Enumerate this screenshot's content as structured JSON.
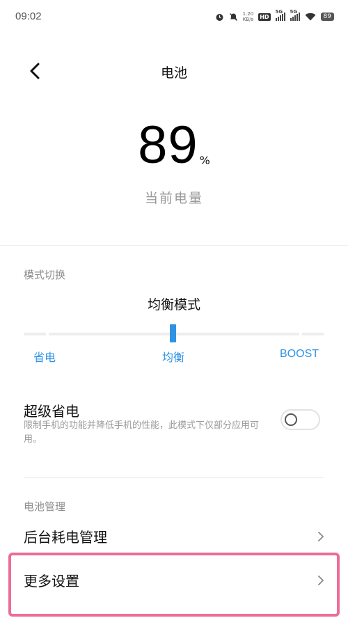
{
  "status_bar": {
    "time": "09:02",
    "net_speed_value": "1.20",
    "net_speed_unit": "KB/s",
    "hd_label": "HD",
    "sim1_label": "5G",
    "sim2_label": "5G",
    "battery_level": "89",
    "icons": [
      "alarm-icon",
      "mute-icon",
      "hd-icon",
      "signal-icon",
      "signal-icon",
      "wifi-icon",
      "battery-icon"
    ]
  },
  "header": {
    "back_icon": "chevron-left-icon",
    "title": "电池"
  },
  "battery": {
    "percent": "89",
    "percent_unit": "%",
    "current_label": "当前电量"
  },
  "mode": {
    "section_label": "模式切换",
    "current_mode": "均衡模式",
    "options": [
      "省电",
      "均衡",
      "BOOST"
    ],
    "selected_index": 1,
    "accent_color": "#2f92e4"
  },
  "super_saver": {
    "title": "超级省电",
    "description": "限制手机的功能并降低手机的性能，此模式下仅部分应用可用。",
    "enabled": false
  },
  "management": {
    "section_label": "电池管理",
    "items": [
      {
        "label": "后台耗电管理",
        "icon": "chevron-right-icon"
      },
      {
        "label": "更多设置",
        "icon": "chevron-right-icon"
      }
    ],
    "highlight_color": "#ec6c9a"
  }
}
